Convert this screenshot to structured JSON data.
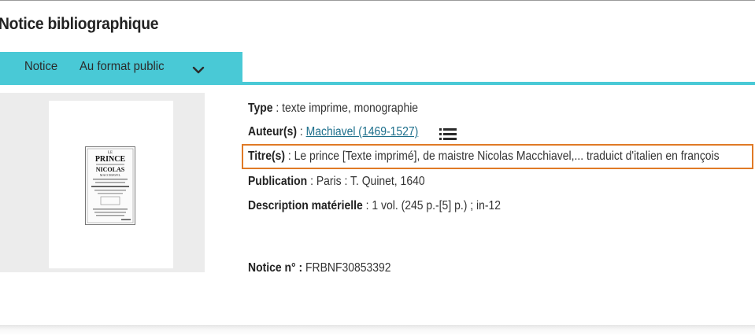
{
  "page": {
    "title": "Notice bibliographique"
  },
  "tabs": {
    "notice_label": "Notice",
    "format_label": "Au format public",
    "dropdown_icon": "chevron-down-icon"
  },
  "record": {
    "type_label": "Type",
    "type_value": " : texte imprime, monographie",
    "author_label": "Auteur(s)",
    "author_sep": " : ",
    "author_value": "Machiavel (1469-1527)",
    "author_list_icon": "list-icon",
    "title_label": "Titre(s)",
    "title_value": " : Le prince [Texte imprimé], de maistre Nicolas Macchiavel,... traduict d'italien en françois",
    "publication_label": "Publication",
    "publication_value": " : Paris : T. Quinet, 1640",
    "description_label": "Description matérielle",
    "description_value": " : 1 vol. (245 p.-[5] p.) ; in-12",
    "notice_label": "Notice n° :",
    "notice_value": " FRBNF30853392"
  },
  "thumbnail": {
    "cover_line1": "LE",
    "cover_line2": "PRINCE",
    "cover_line3": "NICOLAS",
    "cover_line4": "MACCHIAVEL"
  },
  "colors": {
    "tab_bar": "#49c9d6",
    "highlight": "#e07a26",
    "link": "#1d6f8c"
  }
}
